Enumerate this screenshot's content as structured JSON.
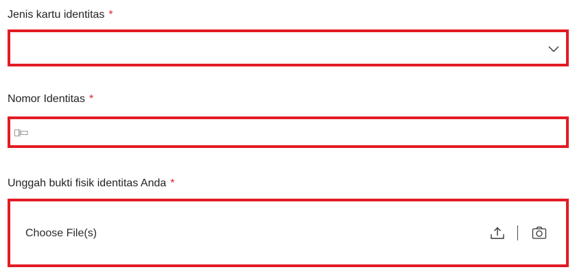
{
  "form": {
    "id_type": {
      "label": "Jenis kartu identitas",
      "required_mark": "*",
      "value": "",
      "icon": "chevron-down-icon"
    },
    "id_number": {
      "label": "Nomor Identitas",
      "required_mark": "*",
      "value": "",
      "icon": "id-card-icon"
    },
    "id_upload": {
      "label": "Unggah bukti fisik identitas Anda",
      "required_mark": "*",
      "button_text": "Choose File(s)",
      "icons": [
        "upload-icon",
        "camera-icon"
      ]
    }
  },
  "colors": {
    "error_border": "#e31b23",
    "required_asterisk": "#e0202a"
  }
}
